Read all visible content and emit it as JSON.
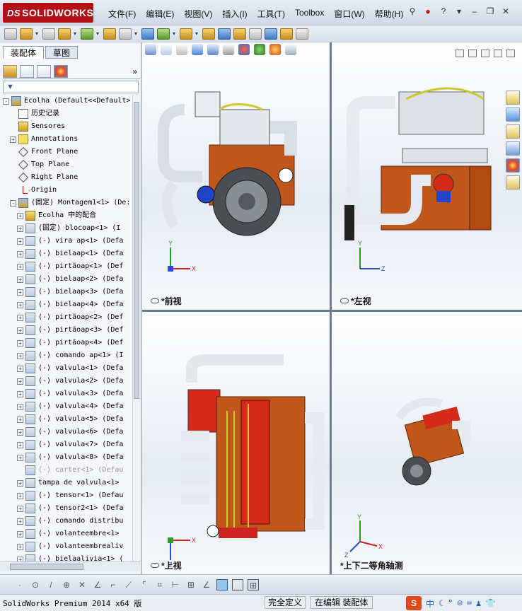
{
  "app": {
    "logo": "SOLIDWORKS",
    "logo_mark": "DS"
  },
  "menu": [
    "文件(F)",
    "编辑(E)",
    "视图(V)",
    "插入(I)",
    "工具(T)",
    "Toolbox",
    "窗口(W)",
    "帮助(H)"
  ],
  "panel": {
    "tabs": [
      "装配体",
      "草图"
    ],
    "tree": [
      {
        "label": "Ecolha  (Default<<Default>",
        "icon": "assembly-icon",
        "expand": "-",
        "indent": 0
      },
      {
        "label": "历史记录",
        "icon": "history-icon",
        "expand": "",
        "indent": 1
      },
      {
        "label": "Sensores",
        "icon": "sensor-icon",
        "expand": "",
        "indent": 1
      },
      {
        "label": "Annotations",
        "icon": "annotation-icon",
        "expand": "+",
        "indent": 1
      },
      {
        "label": "Front Plane",
        "icon": "plane-icon",
        "expand": "",
        "indent": 1
      },
      {
        "label": "Top Plane",
        "icon": "plane-icon",
        "expand": "",
        "indent": 1
      },
      {
        "label": "Right Plane",
        "icon": "plane-icon",
        "expand": "",
        "indent": 1
      },
      {
        "label": "Origin",
        "icon": "origin-icon",
        "expand": "",
        "indent": 1
      },
      {
        "label": "(固定) Montagem1<1> (De:",
        "icon": "assembly-icon",
        "expand": "-",
        "indent": 1
      },
      {
        "label": "Ecolha 中的配合",
        "icon": "mates-icon",
        "expand": "+",
        "indent": 2
      },
      {
        "label": "(固定) blocoap<1> (I",
        "icon": "part-icon",
        "expand": "+",
        "indent": 2
      },
      {
        "label": "(-) vira ap<1> (Defa",
        "icon": "part-icon",
        "expand": "+",
        "indent": 2
      },
      {
        "label": "(-) bielaap<1> (Defa",
        "icon": "part-icon",
        "expand": "+",
        "indent": 2
      },
      {
        "label": "(-) pirtãoap<1> (Def",
        "icon": "part-icon",
        "expand": "+",
        "indent": 2
      },
      {
        "label": "(-) bielaap<2> (Defa",
        "icon": "part-icon",
        "expand": "+",
        "indent": 2
      },
      {
        "label": "(-) bielaap<3> (Defa",
        "icon": "part-icon",
        "expand": "+",
        "indent": 2
      },
      {
        "label": "(-) bielaap<4> (Defa",
        "icon": "part-icon",
        "expand": "+",
        "indent": 2
      },
      {
        "label": "(-) pirtãoap<2> (Def",
        "icon": "part-icon",
        "expand": "+",
        "indent": 2
      },
      {
        "label": "(-) pirtãoap<3> (Def",
        "icon": "part-icon",
        "expand": "+",
        "indent": 2
      },
      {
        "label": "(-) pirtãoap<4> (Def",
        "icon": "part-icon",
        "expand": "+",
        "indent": 2
      },
      {
        "label": "(-) comando ap<1> (I",
        "icon": "part-icon",
        "expand": "+",
        "indent": 2
      },
      {
        "label": "(-) valvula<1> (Defa",
        "icon": "part-icon",
        "expand": "+",
        "indent": 2
      },
      {
        "label": "(-) valvula<2> (Defa",
        "icon": "part-icon",
        "expand": "+",
        "indent": 2
      },
      {
        "label": "(-) valvula<3> (Defa",
        "icon": "part-icon",
        "expand": "+",
        "indent": 2
      },
      {
        "label": "(-) valvula<4> (Defa",
        "icon": "part-icon",
        "expand": "+",
        "indent": 2
      },
      {
        "label": "(-) valvula<5> (Defa",
        "icon": "part-icon",
        "expand": "+",
        "indent": 2
      },
      {
        "label": "(-) valvula<6> (Defa",
        "icon": "part-icon",
        "expand": "+",
        "indent": 2
      },
      {
        "label": "(-) valvula<7> (Defa",
        "icon": "part-icon",
        "expand": "+",
        "indent": 2
      },
      {
        "label": "(-) valvula<8> (Defa",
        "icon": "part-icon",
        "expand": "+",
        "indent": 2
      },
      {
        "label": "(-) carter<1> (Defau",
        "icon": "part-icon",
        "expand": "",
        "indent": 2,
        "suppressed": true
      },
      {
        "label": "tampa de valvula<1>",
        "icon": "part-icon",
        "expand": "+",
        "indent": 2
      },
      {
        "label": "(-) tensor<1> (Defau",
        "icon": "part-icon",
        "expand": "+",
        "indent": 2
      },
      {
        "label": "(-) tensor2<1> (Defa",
        "icon": "part-icon",
        "expand": "+",
        "indent": 2
      },
      {
        "label": "(-) comando distribu",
        "icon": "part-icon",
        "expand": "+",
        "indent": 2
      },
      {
        "label": "(-) volanteembre<1>",
        "icon": "part-icon",
        "expand": "+",
        "indent": 2
      },
      {
        "label": "(-) volanteembrealiv",
        "icon": "part-icon",
        "expand": "+",
        "indent": 2
      },
      {
        "label": "(-) bielaalivia<1> (",
        "icon": "part-icon",
        "expand": "+",
        "indent": 2
      }
    ]
  },
  "views": {
    "front": {
      "label": "*前视",
      "axes": [
        "Y",
        "X"
      ]
    },
    "left": {
      "label": "*左视",
      "axes": [
        "Y",
        "Z"
      ]
    },
    "top": {
      "label": "*上视",
      "axes": [
        "X",
        "Z"
      ]
    },
    "iso": {
      "label": "*上下二等角轴测",
      "axes": [
        "Y",
        "X",
        "Z"
      ]
    }
  },
  "status": {
    "product": "SolidWorks Premium 2014 x64 版",
    "definition": "完全定义",
    "mode": "在编辑 装配体",
    "ime_logo": "S",
    "ime_lang": "中"
  },
  "colors": {
    "engine_block": "#c0561a",
    "pipes": "#e9edf2",
    "head": "#d8dde3",
    "red_part": "#d32a1a",
    "blue_part": "#2245c8",
    "accent_red": "#b3101a"
  }
}
